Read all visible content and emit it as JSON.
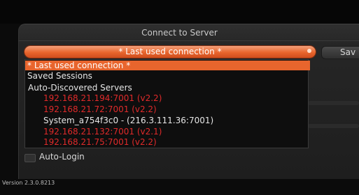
{
  "dialog": {
    "title": "Connect to Server",
    "save_label": "Sav",
    "auto_login_label": "Auto-Login"
  },
  "connection_combo": {
    "selected_value": "* Last used connection *"
  },
  "dropdown": {
    "selected_item": "* Last used connection *",
    "saved_sessions_label": "Saved Sessions",
    "auto_discovered_label": "Auto-Discovered Servers",
    "servers": [
      {
        "label": "192.168.21.194:7001 (v2.2)",
        "status": "incompatible"
      },
      {
        "label": "192.168.21.72:7001 (v2.2)",
        "status": "incompatible"
      },
      {
        "label": "System_a754f3c0 - (216.3.111.36:7001)",
        "status": "compatible"
      },
      {
        "label": "192.168.21.132:7001 (v2.1)",
        "status": "incompatible"
      },
      {
        "label": "192.168.21.75:7001 (v2.2)",
        "status": "incompatible"
      }
    ]
  },
  "footer": {
    "version": "Version 2.3.0.8213"
  },
  "colors": {
    "accent_orange": "#e8652d",
    "incompatible_red": "#e02a2a",
    "background": "#0b0b0b"
  }
}
